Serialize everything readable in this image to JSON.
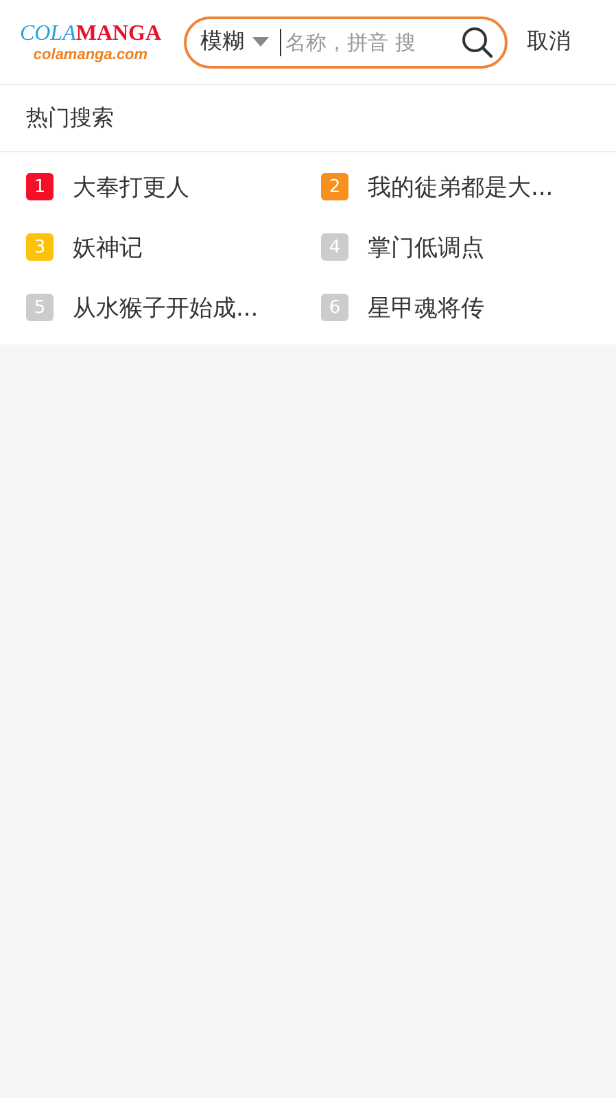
{
  "logo": {
    "brand_part_1": "COLA",
    "brand_part_2": "MANGA",
    "domain": "colamanga.com"
  },
  "search": {
    "mode": "模糊",
    "placeholder": "名称，拼音 搜"
  },
  "cancel": "取消",
  "hot_search": {
    "title": "热门搜索",
    "items": [
      {
        "rank": "1",
        "title": "大奉打更人",
        "color": "#f5102a"
      },
      {
        "rank": "2",
        "title": "我的徒弟都是大...",
        "color": "#f7901e"
      },
      {
        "rank": "3",
        "title": "妖神记",
        "color": "#fdc20c"
      },
      {
        "rank": "4",
        "title": "掌门低调点",
        "color": "#cccccc"
      },
      {
        "rank": "5",
        "title": "从水猴子开始成...",
        "color": "#cccccc"
      },
      {
        "rank": "6",
        "title": "星甲魂将传",
        "color": "#cccccc"
      }
    ]
  }
}
